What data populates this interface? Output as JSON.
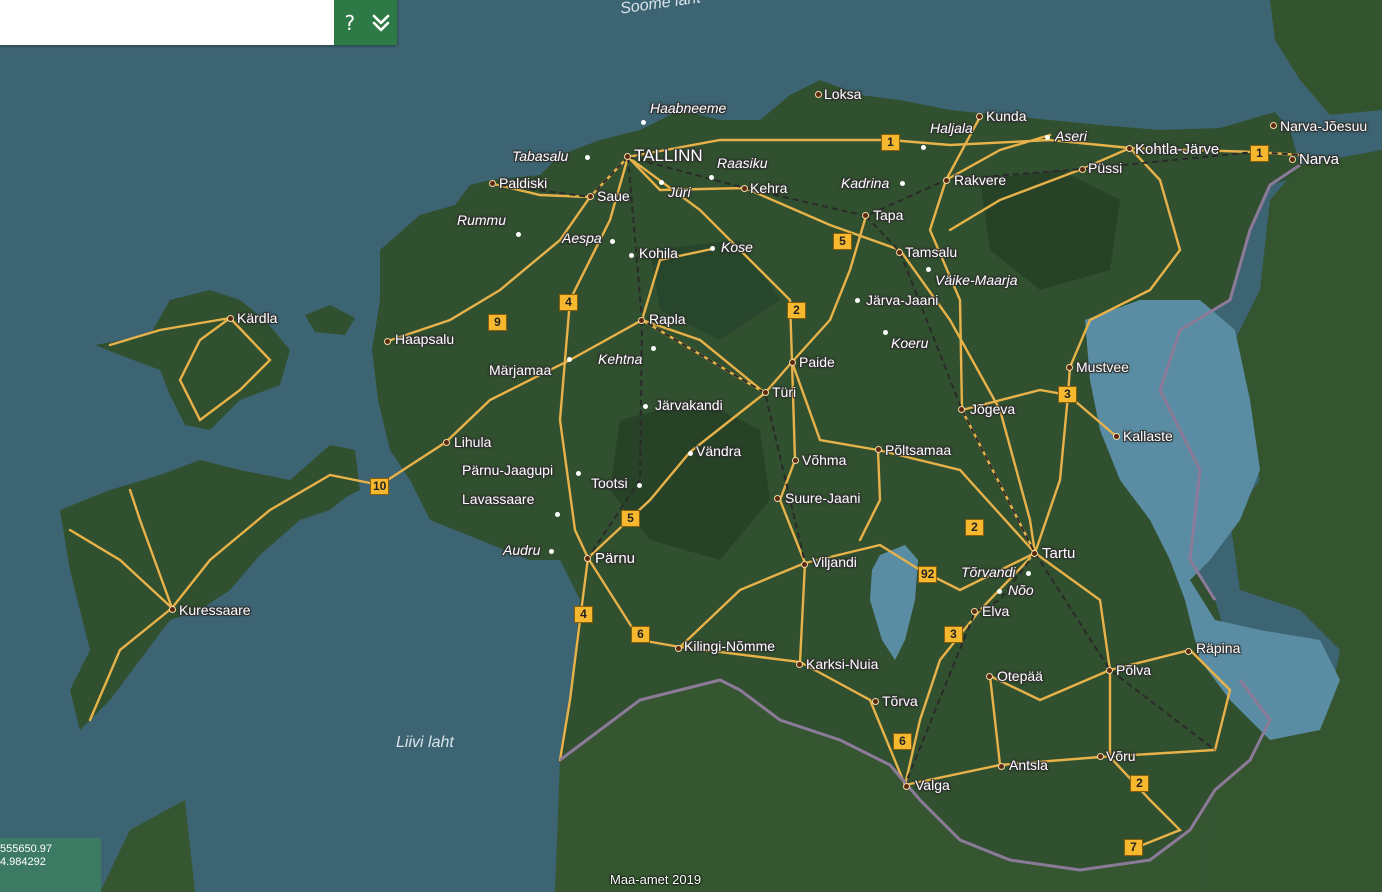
{
  "search": {
    "placeholder": "",
    "help_label": "?",
    "expand_label": "»"
  },
  "colors": {
    "sea": "#3c6270",
    "land": "#2f4a2e",
    "road": "#e8b24a",
    "railway": "#2b2b2b",
    "border": "#8c7a99",
    "panel_green": "#2e7a46",
    "shield_bg": "#f5b82e"
  },
  "coordinates": {
    "line1": "555650.97",
    "line2": "4.984292"
  },
  "attribution": "Maa-amet 2019",
  "water_labels": [
    "Soome laht",
    "Liivi laht"
  ],
  "places": [
    {
      "name": "TALLINN",
      "kind": "capital"
    },
    {
      "name": "Paldiski",
      "kind": "town"
    },
    {
      "name": "Tabasalu",
      "kind": "village"
    },
    {
      "name": "Haabneeme",
      "kind": "village"
    },
    {
      "name": "Saue",
      "kind": "town"
    },
    {
      "name": "Jüri",
      "kind": "village"
    },
    {
      "name": "Raasiku",
      "kind": "village"
    },
    {
      "name": "Kehra",
      "kind": "town"
    },
    {
      "name": "Rummu",
      "kind": "village"
    },
    {
      "name": "Aespa",
      "kind": "village"
    },
    {
      "name": "Kohila",
      "kind": "town"
    },
    {
      "name": "Kose",
      "kind": "village"
    },
    {
      "name": "Loksa",
      "kind": "town"
    },
    {
      "name": "Haljala",
      "kind": "village"
    },
    {
      "name": "Kunda",
      "kind": "town"
    },
    {
      "name": "Aseri",
      "kind": "village"
    },
    {
      "name": "Kohtla-Järve",
      "kind": "city"
    },
    {
      "name": "Narva-Jõesuu",
      "kind": "town"
    },
    {
      "name": "Narva",
      "kind": "city"
    },
    {
      "name": "Püssi",
      "kind": "town"
    },
    {
      "name": "Kadrina",
      "kind": "village"
    },
    {
      "name": "Rakvere",
      "kind": "town"
    },
    {
      "name": "Tapa",
      "kind": "town"
    },
    {
      "name": "Tamsalu",
      "kind": "town"
    },
    {
      "name": "Väike-Maarja",
      "kind": "village"
    },
    {
      "name": "Järva-Jaani",
      "kind": "town"
    },
    {
      "name": "Koeru",
      "kind": "village"
    },
    {
      "name": "Kärdla",
      "kind": "town"
    },
    {
      "name": "Haapsalu",
      "kind": "town"
    },
    {
      "name": "Märjamaa",
      "kind": "town"
    },
    {
      "name": "Rapla",
      "kind": "town"
    },
    {
      "name": "Kehtna",
      "kind": "village"
    },
    {
      "name": "Paide",
      "kind": "town"
    },
    {
      "name": "Türi",
      "kind": "town"
    },
    {
      "name": "Järvakandi",
      "kind": "town"
    },
    {
      "name": "Lihula",
      "kind": "town"
    },
    {
      "name": "Pärnu-Jaagupi",
      "kind": "town"
    },
    {
      "name": "Tootsi",
      "kind": "town"
    },
    {
      "name": "Vändra",
      "kind": "town"
    },
    {
      "name": "Võhma",
      "kind": "town"
    },
    {
      "name": "Põltsamaa",
      "kind": "town"
    },
    {
      "name": "Jõgeva",
      "kind": "town"
    },
    {
      "name": "Mustvee",
      "kind": "town"
    },
    {
      "name": "Kallaste",
      "kind": "town"
    },
    {
      "name": "Lavassaare",
      "kind": "town"
    },
    {
      "name": "Suure-Jaani",
      "kind": "town"
    },
    {
      "name": "Audru",
      "kind": "village"
    },
    {
      "name": "Pärnu",
      "kind": "city"
    },
    {
      "name": "Viljandi",
      "kind": "town"
    },
    {
      "name": "Tartu",
      "kind": "city"
    },
    {
      "name": "Tõrvandi",
      "kind": "village"
    },
    {
      "name": "Nõo",
      "kind": "village"
    },
    {
      "name": "Elva",
      "kind": "town"
    },
    {
      "name": "Kuressaare",
      "kind": "town"
    },
    {
      "name": "Kilingi-Nõmme",
      "kind": "town"
    },
    {
      "name": "Karksi-Nuia",
      "kind": "town"
    },
    {
      "name": "Räpina",
      "kind": "town"
    },
    {
      "name": "Põlva",
      "kind": "town"
    },
    {
      "name": "Otepää",
      "kind": "town"
    },
    {
      "name": "Tõrva",
      "kind": "town"
    },
    {
      "name": "Antsla",
      "kind": "town"
    },
    {
      "name": "Võru",
      "kind": "town"
    },
    {
      "name": "Valga",
      "kind": "town"
    }
  ],
  "road_shields": [
    "1",
    "1",
    "5",
    "4",
    "9",
    "2",
    "3",
    "10",
    "5",
    "2",
    "92",
    "4",
    "6",
    "3",
    "6",
    "2",
    "7"
  ]
}
